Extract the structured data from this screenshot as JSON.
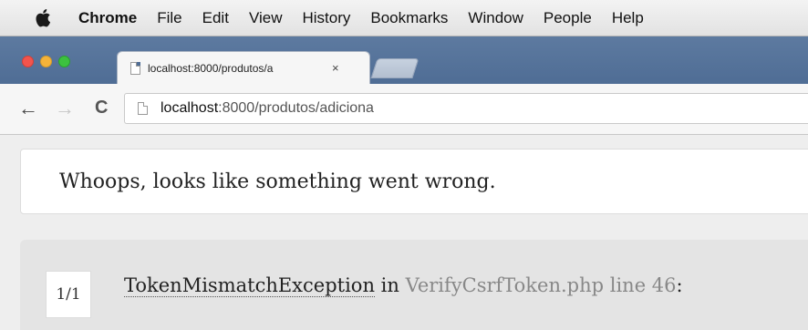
{
  "menubar": {
    "apple_icon": "apple-logo-icon",
    "app_name": "Chrome",
    "items": [
      "File",
      "Edit",
      "View",
      "History",
      "Bookmarks",
      "Window",
      "People",
      "Help"
    ]
  },
  "tab": {
    "title": "localhost:8000/produtos/a",
    "close": "×"
  },
  "toolbar": {
    "back": "←",
    "forward": "→",
    "reload": "C",
    "url_host": "localhost",
    "url_rest": ":8000/produtos/adiciona"
  },
  "page": {
    "whoops": "Whoops, looks like something went wrong.",
    "counter": "1/1",
    "exception_class": "TokenMismatchException",
    "exception_in": " in ",
    "exception_file": "VerifyCsrfToken.php line 46",
    "exception_suffix": ":"
  },
  "colors": {
    "tabstrip": "#5d7aa0",
    "traffic_red": "#f2544d",
    "traffic_yellow": "#f4b33a",
    "traffic_green": "#3cc13f"
  }
}
